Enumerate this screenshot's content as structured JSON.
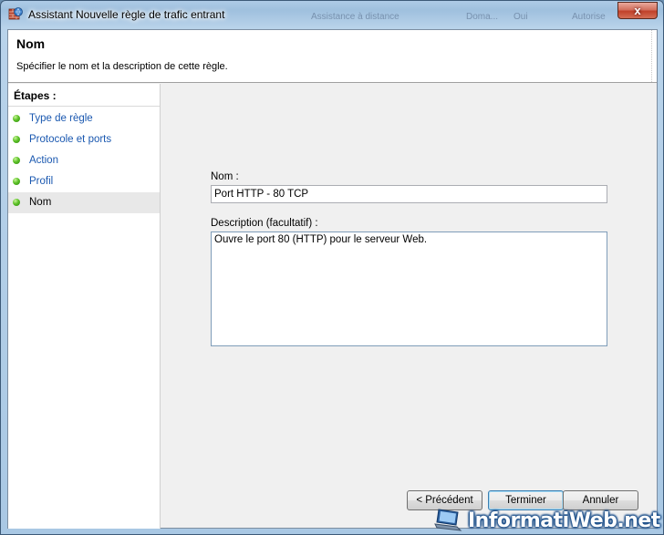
{
  "window": {
    "title": "Assistant Nouvelle règle de trafic entrant",
    "close_glyph": "x",
    "background_ghost_texts": [
      "Assistance à distance",
      "Doma...",
      "Oui",
      "Autorise"
    ]
  },
  "header": {
    "title": "Nom",
    "subtitle": "Spécifier le nom et la description de cette règle."
  },
  "steps": {
    "heading": "Étapes :",
    "items": [
      {
        "label": "Type de règle",
        "current": false
      },
      {
        "label": "Protocole et ports",
        "current": false
      },
      {
        "label": "Action",
        "current": false
      },
      {
        "label": "Profil",
        "current": false
      },
      {
        "label": "Nom",
        "current": true
      }
    ]
  },
  "form": {
    "name_label": "Nom :",
    "name_value": "Port HTTP - 80 TCP",
    "description_label": "Description (facultatif) :",
    "description_value": "Ouvre le port 80 (HTTP) pour le serveur Web."
  },
  "buttons": {
    "previous": "< Précédent",
    "finish": "Terminer",
    "cancel": "Annuler"
  },
  "watermark": {
    "text": "InformatiWeb.net"
  },
  "colors": {
    "link_blue": "#1a58b0",
    "step_dot_green": "#5dc128",
    "close_red": "#c0412a"
  },
  "icons": {
    "title": "firewall-shield-icon",
    "step": "green-dot-icon",
    "watermark": "laptop-icon"
  }
}
